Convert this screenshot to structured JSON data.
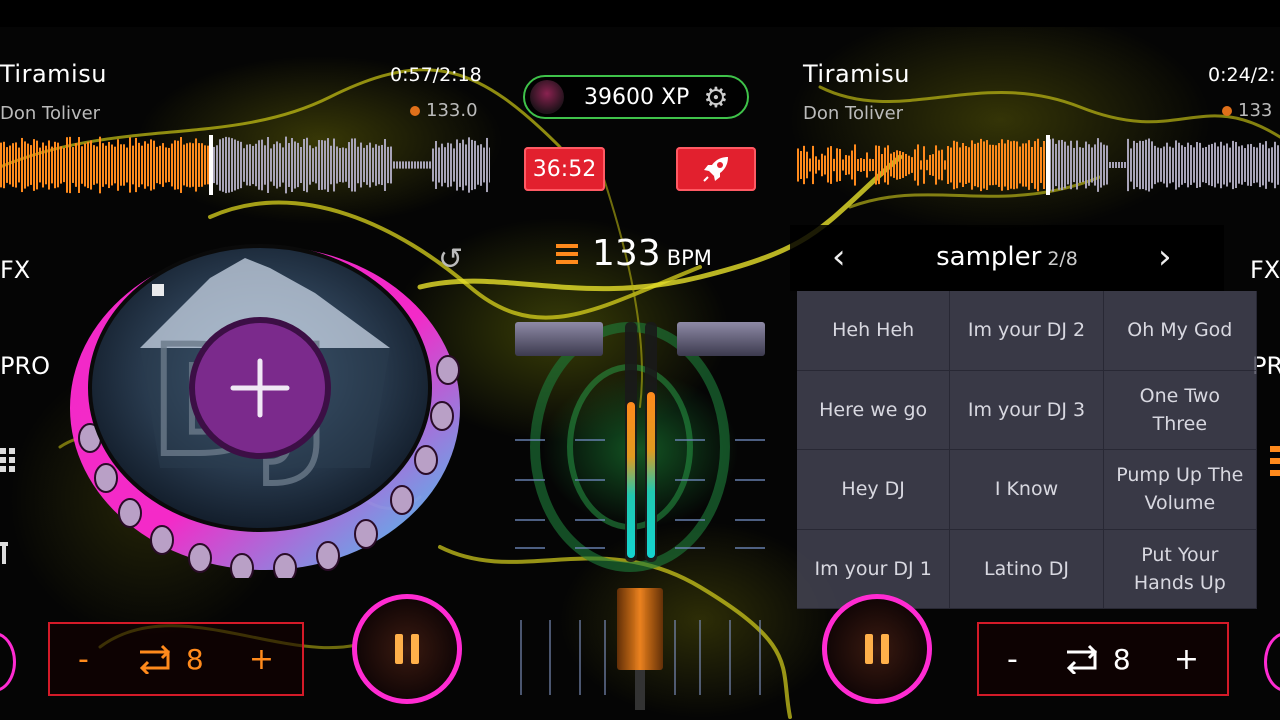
{
  "left_deck": {
    "title": "Tiramisu",
    "artist": "Don Toliver",
    "time": "0:57/2:18",
    "bpm": "133.0",
    "fx_label": "FX",
    "pro_label": "PRO",
    "loop_minus": "-",
    "loop_value": "8",
    "loop_plus": "+",
    "progress": 0.43
  },
  "right_deck": {
    "title": "Tiramisu",
    "artist": "Don Toliver",
    "time": "0:24/2:",
    "bpm": "133",
    "fx_label": "FX",
    "pro_label": "PR",
    "loop_minus": "-",
    "loop_value": "8",
    "loop_plus": "+",
    "progress": 0.52
  },
  "header": {
    "xp": "39600 XP",
    "timer": "36:52"
  },
  "mixer": {
    "bpm_value": "133",
    "bpm_unit": "BPM"
  },
  "sampler": {
    "title": "sampler",
    "page": "2/8",
    "pads": [
      "Heh Heh",
      "Im your DJ 2",
      "Oh My God",
      "Here we go",
      "Im your DJ 3",
      "One Two Three",
      "Hey DJ",
      "I Know",
      "Pump Up The Volume",
      "Im your DJ 1",
      "Latino DJ",
      "Put Your Hands Up"
    ]
  },
  "icons": {
    "settings": "gear-icon",
    "boost": "rocket-icon",
    "add_track": "plus-icon",
    "loop": "loop-icon",
    "pause": "pause-icon",
    "menu": "menu-icon",
    "undo": "undo-icon"
  },
  "colors": {
    "accent_orange": "#ff8a1c",
    "accent_magenta": "#ff2bd2",
    "accent_red": "#e2202e",
    "xp_green": "#3fc24a"
  }
}
